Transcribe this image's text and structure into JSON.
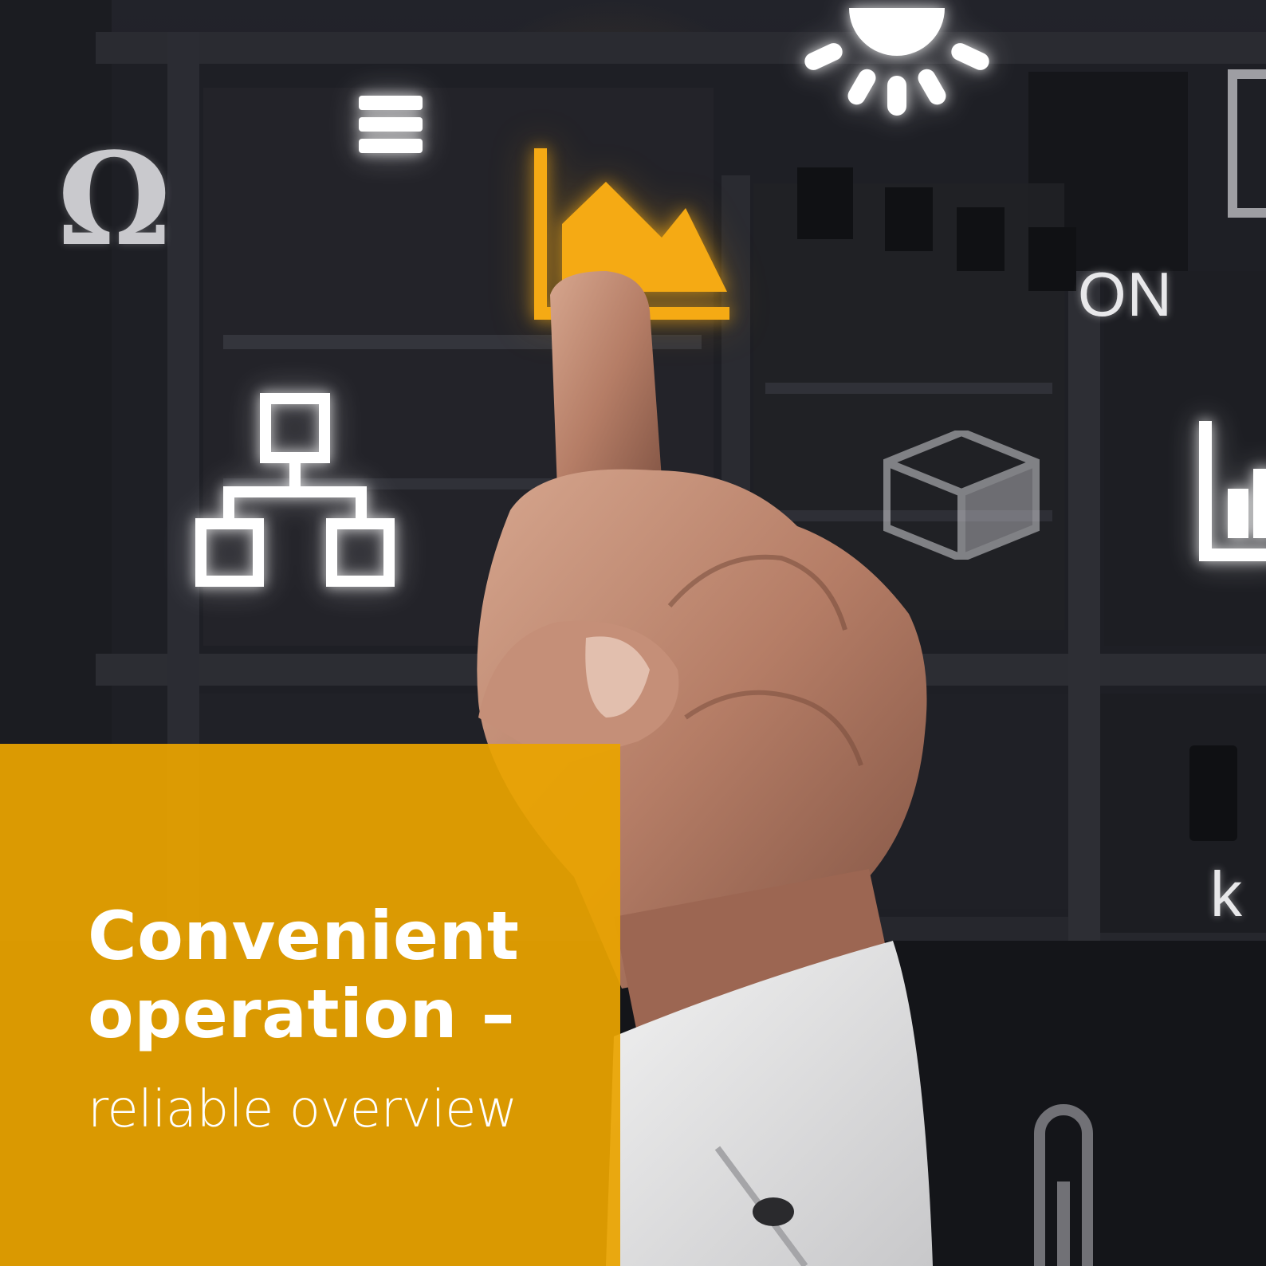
{
  "scene": {
    "headline": {
      "title_line1": "Convenient",
      "title_line2": "operation –",
      "subtitle": "reliable overview"
    },
    "floating_labels": {
      "on": "ON",
      "unit_k": "k"
    },
    "icons": {
      "omega_glyph": "Ω",
      "names": [
        "omega-icon",
        "menu-icon",
        "sun-icon",
        "area-chart-icon",
        "network-icon",
        "box-icon",
        "bar-chart-icon",
        "frame-icon",
        "thermometer-icon"
      ]
    },
    "colors": {
      "accent_orange": "#E9A400",
      "highlight_orange": "#F5AA14",
      "icon_white": "#FFFFFF",
      "background_dark": "#1A1A1F"
    }
  }
}
